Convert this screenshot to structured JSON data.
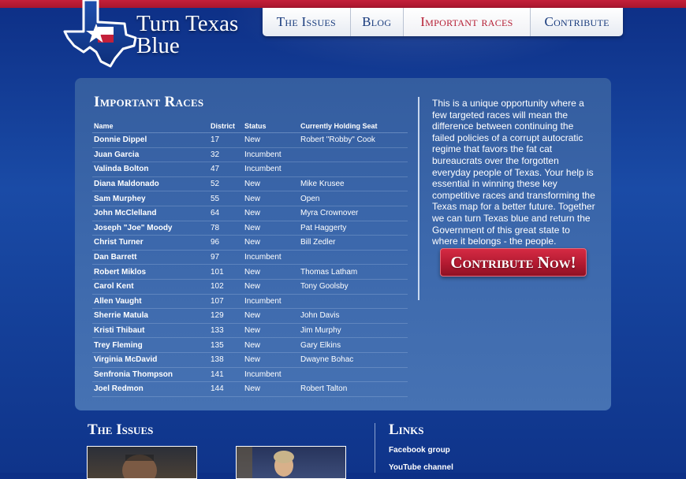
{
  "logo": {
    "title": "Turn Texas Blue"
  },
  "nav": {
    "items": [
      {
        "label": "The Issues"
      },
      {
        "label": "Blog"
      },
      {
        "label": "Important races"
      },
      {
        "label": "Contribute"
      }
    ],
    "active_index": 2
  },
  "races": {
    "title": "Important Races",
    "headers": {
      "name": "Name",
      "district": "District",
      "status": "Status",
      "seat": "Currently Holding Seat"
    },
    "rows": [
      {
        "name": "Donnie Dippel",
        "district": "17",
        "status": "New",
        "seat": "Robert \"Robby\" Cook"
      },
      {
        "name": "Juan Garcia",
        "district": "32",
        "status": "Incumbent",
        "seat": ""
      },
      {
        "name": "Valinda Bolton",
        "district": "47",
        "status": "Incumbent",
        "seat": ""
      },
      {
        "name": "Diana Maldonado",
        "district": "52",
        "status": "New",
        "seat": "Mike Krusee"
      },
      {
        "name": "Sam Murphey",
        "district": "55",
        "status": "New",
        "seat": "Open"
      },
      {
        "name": "John McClelland",
        "district": "64",
        "status": "New",
        "seat": "Myra Crownover"
      },
      {
        "name": "Joseph \"Joe\" Moody",
        "district": "78",
        "status": "New",
        "seat": "Pat Haggerty"
      },
      {
        "name": "Christ Turner",
        "district": "96",
        "status": "New",
        "seat": "Bill Zedler"
      },
      {
        "name": "Dan Barrett",
        "district": "97",
        "status": "Incumbent",
        "seat": ""
      },
      {
        "name": "Robert Miklos",
        "district": "101",
        "status": "New",
        "seat": "Thomas Latham"
      },
      {
        "name": "Carol Kent",
        "district": "102",
        "status": "New",
        "seat": "Tony Goolsby"
      },
      {
        "name": "Allen Vaught",
        "district": "107",
        "status": "Incumbent",
        "seat": ""
      },
      {
        "name": "Sherrie Matula",
        "district": "129",
        "status": "New",
        "seat": "John Davis"
      },
      {
        "name": "Kristi Thibaut",
        "district": "133",
        "status": "New",
        "seat": "Jim Murphy"
      },
      {
        "name": "Trey Fleming",
        "district": "135",
        "status": "New",
        "seat": "Gary Elkins"
      },
      {
        "name": "Virginia McDavid",
        "district": "138",
        "status": "New",
        "seat": "Dwayne Bohac"
      },
      {
        "name": "Senfronia Thompson",
        "district": "141",
        "status": "Incumbent",
        "seat": ""
      },
      {
        "name": "Joel Redmon",
        "district": "144",
        "status": "New",
        "seat": "Robert Talton"
      }
    ]
  },
  "blurb": "This is a unique opportunity where a few targeted races will mean the difference between continuing the failed policies of a corrupt autocratic regime that favors the fat cat bureaucrats over the forgotten everyday people of Texas. Your help is essential in winning these key competitive races and transforming the Texas map for a better future. Together we can turn Texas blue and return the Government of this great state to where it belongs - the people.",
  "contribute_button": "Contribute Now!",
  "issues": {
    "title": "The Issues"
  },
  "links": {
    "title": "Links",
    "items": [
      {
        "label": "Facebook group"
      },
      {
        "label": "YouTube channel"
      }
    ]
  },
  "colors": {
    "background": "#1a4ba6",
    "accent_red": "#b51d33",
    "nav_text": "#173a7c",
    "panel": "#3b67ab"
  }
}
